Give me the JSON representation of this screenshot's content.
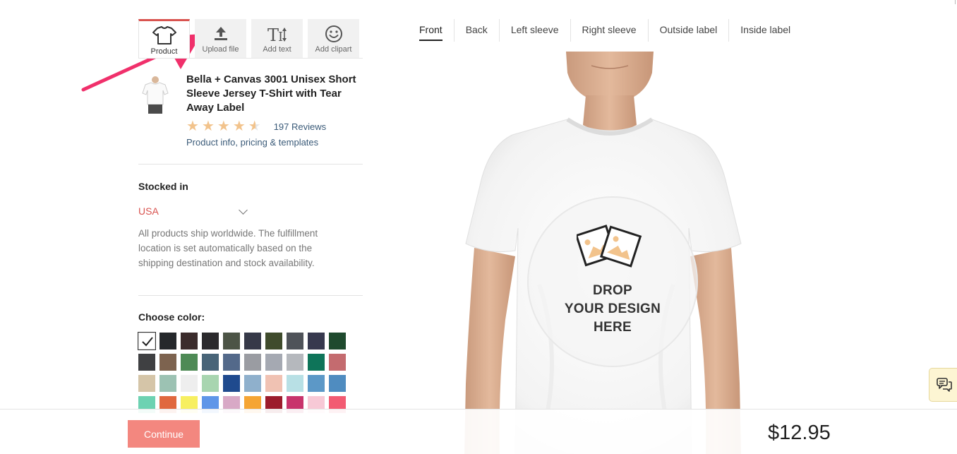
{
  "tools": [
    {
      "label": "Product",
      "icon": "tshirt-icon",
      "active": true
    },
    {
      "label": "Upload file",
      "icon": "upload-icon",
      "active": false
    },
    {
      "label": "Add text",
      "icon": "add-text-icon",
      "active": false
    },
    {
      "label": "Add clipart",
      "icon": "smiley-icon",
      "active": false
    }
  ],
  "product": {
    "title": "Bella + Canvas 3001 Unisex Short Sleeve Jersey T-Shirt with Tear Away Label",
    "rating": 4.5,
    "reviews": "197 Reviews",
    "info_link": "Product info, pricing & templates"
  },
  "stock": {
    "label": "Stocked in",
    "country": "USA",
    "note": "All products ship worldwide. The fulfillment location is set automatically based on the shipping destination and stock availability."
  },
  "colors": {
    "label": "Choose color:",
    "selected_index": 0,
    "swatches": [
      "#ffffff",
      "#25282b",
      "#3b2c2c",
      "#2b2a2d",
      "#4c5446",
      "#363948",
      "#3f4b2c",
      "#4f5359",
      "#37394e",
      "#1f4a2e",
      "#3f4042",
      "#7d634f",
      "#4e8a55",
      "#486478",
      "#53698a",
      "#9a9ca2",
      "#a5a9b2",
      "#b5b8bd",
      "#0e7459",
      "#c46b6f",
      "#d5c5a8",
      "#9cc2b3",
      "#eeeeee",
      "#a8d5b0",
      "#1f4a8e",
      "#8fb0cc",
      "#f0c2b3",
      "#b8e0e5",
      "#5c98c7",
      "#4f8cc0",
      "#6dd2b2",
      "#e0683f",
      "#f7ef60",
      "#5f96e8",
      "#d8a9c6",
      "#f5a534",
      "#9c1c2c",
      "#c8346c",
      "#f7c9d6",
      "#f25b72"
    ]
  },
  "views": {
    "active_index": 0,
    "tabs": [
      "Front",
      "Back",
      "Left sleeve",
      "Right sleeve",
      "Outside label",
      "Inside label"
    ]
  },
  "drop_zone": {
    "line1": "DROP",
    "line2": "YOUR DESIGN",
    "line3": "HERE"
  },
  "footer": {
    "continue_label": "Continue",
    "price": "$12.95"
  },
  "accent_color": "#d9534f"
}
